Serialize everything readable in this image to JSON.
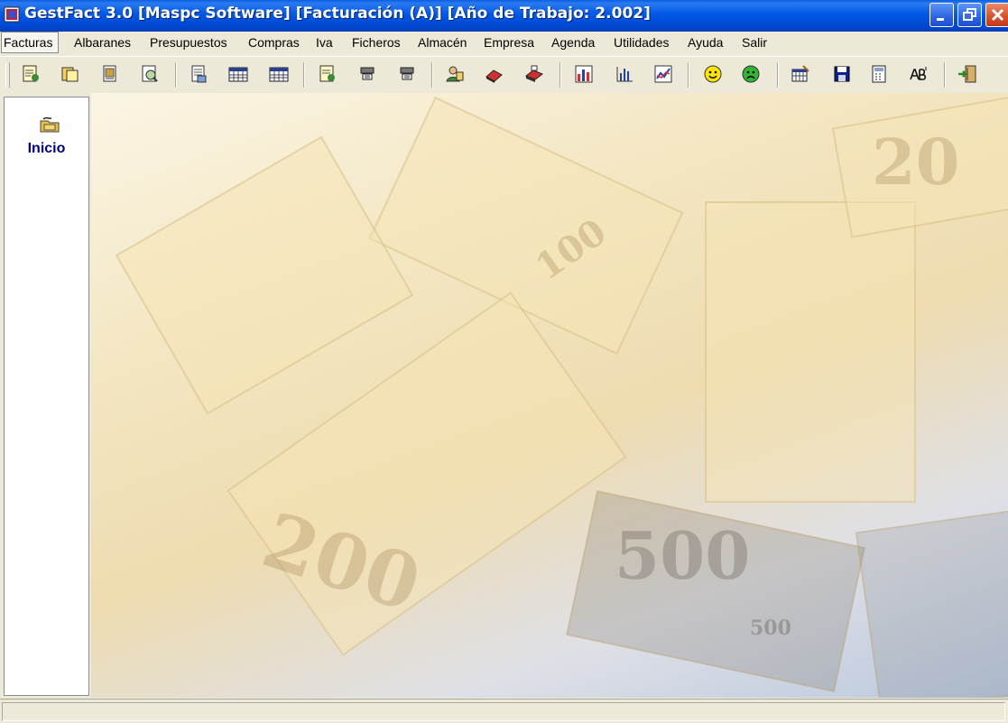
{
  "window": {
    "title": "GestFact 3.0 [Maspc Software] [Facturación (A)] [Año de Trabajo: 2.002]",
    "controls": [
      "minimize-icon",
      "restore-icon",
      "close-icon"
    ]
  },
  "menu": {
    "items": [
      "Facturas",
      "Albaranes",
      "Presupuestos",
      "Compras",
      "Iva",
      "Ficheros",
      "Almacén",
      "Empresa",
      "Agenda",
      "Utilidades",
      "Ayuda",
      "Salir"
    ],
    "active": "Facturas"
  },
  "toolbar": {
    "buttons": [
      "new-invoice-icon",
      "copy-invoice-icon",
      "print-invoice-icon",
      "search-invoice-icon",
      "new-delivery-note-icon",
      "grid-table-icon",
      "grid-table-2-icon",
      "edit-document-icon",
      "stamp-icon",
      "stamp-2-icon",
      "client-icon",
      "eraser-icon",
      "printer-icon",
      "bar-chart-icon",
      "column-chart-icon",
      "line-chart-icon",
      "happy-face-icon",
      "sad-face-icon",
      "calendar-edit-icon",
      "save-disk-icon",
      "calculator-icon",
      "ab-text-icon",
      "exit-door-icon"
    ]
  },
  "sidebar": {
    "items": [
      {
        "label": "Inicio",
        "icon": "folder-hand-icon"
      }
    ]
  },
  "main": {
    "background": "euro-banknotes-image",
    "banknote_labels": [
      "20",
      "100",
      "500",
      "200",
      "500"
    ]
  },
  "colors": {
    "title_bar": "#0058e6",
    "chrome": "#ece9d8",
    "sidebar_label": "#000080"
  }
}
